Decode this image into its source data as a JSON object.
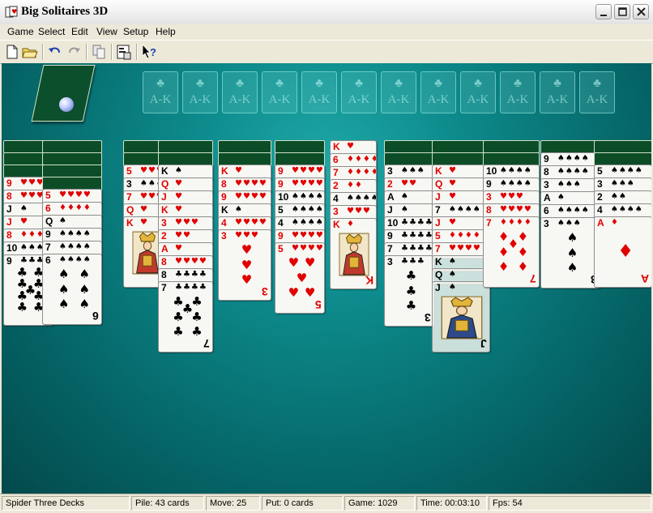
{
  "window": {
    "title": "Big Solitaires 3D"
  },
  "menu": [
    "Game",
    "Select",
    "Edit",
    "View",
    "Setup",
    "Help"
  ],
  "toolbar": [
    "new-game-icon",
    "open-icon",
    "undo-icon",
    "redo-icon",
    "copy-icon",
    "properties-icon",
    "help-pointer-icon"
  ],
  "colors": {
    "felt": "#0d8a8b",
    "card_back": "#0c4d27",
    "red_suit": "#e00000",
    "black_suit": "#000000"
  },
  "foundations": {
    "label": "A-K",
    "slots": [
      {
        "suit": "♣"
      },
      {
        "suit": "♣"
      },
      {
        "suit": "♣"
      },
      {
        "suit": "♣"
      },
      {
        "suit": "♣"
      },
      {
        "suit": "♣"
      },
      {
        "suit": "♣"
      },
      {
        "suit": "♣"
      },
      {
        "suit": "♣"
      },
      {
        "suit": "♣"
      },
      {
        "suit": "♣"
      },
      {
        "suit": "♣"
      }
    ]
  },
  "tableau": [
    {
      "down": 3,
      "cards": [
        {
          "r": "9",
          "s": "♥"
        },
        {
          "r": "8",
          "s": "♥"
        },
        {
          "r": "J",
          "s": "♠"
        },
        {
          "r": "J",
          "s": "♥"
        },
        {
          "r": "8",
          "s": "♦"
        },
        {
          "r": "10",
          "s": "♠"
        },
        {
          "r": "9",
          "s": "♣"
        }
      ]
    },
    {
      "down": 4,
      "cards": [
        {
          "r": "5",
          "s": "♥"
        },
        {
          "r": "6",
          "s": "♦"
        },
        {
          "r": "Q",
          "s": "♠"
        },
        {
          "r": "9",
          "s": "♠"
        },
        {
          "r": "7",
          "s": "♠"
        },
        {
          "r": "6",
          "s": "♠"
        }
      ]
    },
    {
      "down": 2,
      "cards": [
        {
          "r": "5",
          "s": "♥"
        },
        {
          "r": "3",
          "s": "♠"
        },
        {
          "r": "7",
          "s": "♥"
        },
        {
          "r": "Q",
          "s": "♥"
        },
        {
          "r": "K",
          "s": "♥"
        }
      ]
    },
    {
      "down": 2,
      "cards": [
        {
          "r": "K",
          "s": "♠"
        },
        {
          "r": "Q",
          "s": "♥"
        },
        {
          "r": "J",
          "s": "♥"
        },
        {
          "r": "K",
          "s": "♥"
        },
        {
          "r": "3",
          "s": "♥"
        },
        {
          "r": "2",
          "s": "♥"
        },
        {
          "r": "A",
          "s": "♥"
        },
        {
          "r": "8",
          "s": "♥"
        },
        {
          "r": "8",
          "s": "♣"
        },
        {
          "r": "7",
          "s": "♣"
        }
      ]
    },
    {
      "down": 2,
      "cards": [
        {
          "r": "K",
          "s": "♥"
        },
        {
          "r": "8",
          "s": "♥"
        },
        {
          "r": "9",
          "s": "♥"
        },
        {
          "r": "K",
          "s": "♠"
        },
        {
          "r": "4",
          "s": "♥"
        },
        {
          "r": "3",
          "s": "♥"
        }
      ]
    },
    {
      "down": 2,
      "cards": [
        {
          "r": "9",
          "s": "♥"
        },
        {
          "r": "9",
          "s": "♥"
        },
        {
          "r": "10",
          "s": "♠"
        },
        {
          "r": "5",
          "s": "♠"
        },
        {
          "r": "4",
          "s": "♠"
        },
        {
          "r": "9",
          "s": "♥"
        },
        {
          "r": "5",
          "s": "♥"
        }
      ]
    },
    {
      "down": 0,
      "cards": [
        {
          "r": "K",
          "s": "♥"
        },
        {
          "r": "6",
          "s": "♦"
        },
        {
          "r": "7",
          "s": "♦"
        },
        {
          "r": "2",
          "s": "♦"
        },
        {
          "r": "4",
          "s": "♠"
        },
        {
          "r": "3",
          "s": "♥"
        },
        {
          "r": "K",
          "s": "♦"
        }
      ]
    },
    {
      "down": 2,
      "cards": [
        {
          "r": "3",
          "s": "♠"
        },
        {
          "r": "2",
          "s": "♥"
        },
        {
          "r": "A",
          "s": "♠"
        },
        {
          "r": "J",
          "s": "♠"
        },
        {
          "r": "10",
          "s": "♣"
        },
        {
          "r": "9",
          "s": "♣"
        },
        {
          "r": "7",
          "s": "♣"
        },
        {
          "r": "3",
          "s": "♣"
        }
      ]
    },
    {
      "down": 2,
      "cards": [
        {
          "r": "K",
          "s": "♥"
        },
        {
          "r": "Q",
          "s": "♥"
        },
        {
          "r": "J",
          "s": "♥"
        },
        {
          "r": "7",
          "s": "♠"
        },
        {
          "r": "J",
          "s": "♥"
        },
        {
          "r": "5",
          "s": "♦"
        },
        {
          "r": "7",
          "s": "♥"
        },
        {
          "r": "K",
          "s": "♠",
          "ghost": true
        },
        {
          "r": "Q",
          "s": "♠",
          "ghost": true
        },
        {
          "r": "J",
          "s": "♠",
          "ghost": true
        }
      ]
    },
    {
      "down": 2,
      "cards": [
        {
          "r": "10",
          "s": "♠"
        },
        {
          "r": "9",
          "s": "♠"
        },
        {
          "r": "3",
          "s": "♥"
        },
        {
          "r": "8",
          "s": "♥"
        },
        {
          "r": "7",
          "s": "♦"
        }
      ]
    },
    {
      "down": 1,
      "cards": [
        {
          "r": "9",
          "s": "♠"
        },
        {
          "r": "8",
          "s": "♠"
        },
        {
          "r": "3",
          "s": "♠"
        },
        {
          "r": "A",
          "s": "♠"
        },
        {
          "r": "6",
          "s": "♠"
        },
        {
          "r": "3",
          "s": "♠"
        }
      ]
    },
    {
      "down": 2,
      "cards": [
        {
          "r": "5",
          "s": "♠"
        },
        {
          "r": "3",
          "s": "♠"
        },
        {
          "r": "2",
          "s": "♠"
        },
        {
          "r": "4",
          "s": "♠"
        },
        {
          "r": "A",
          "s": "♦"
        }
      ]
    }
  ],
  "status": {
    "game_name": "Spider Three Decks",
    "pile": "Pile: 43 cards",
    "move": "Move: 25",
    "put": "Put: 0 cards",
    "game": "Game: 1029",
    "time": "Time: 00:03:10",
    "fps": "Fps: 54"
  }
}
